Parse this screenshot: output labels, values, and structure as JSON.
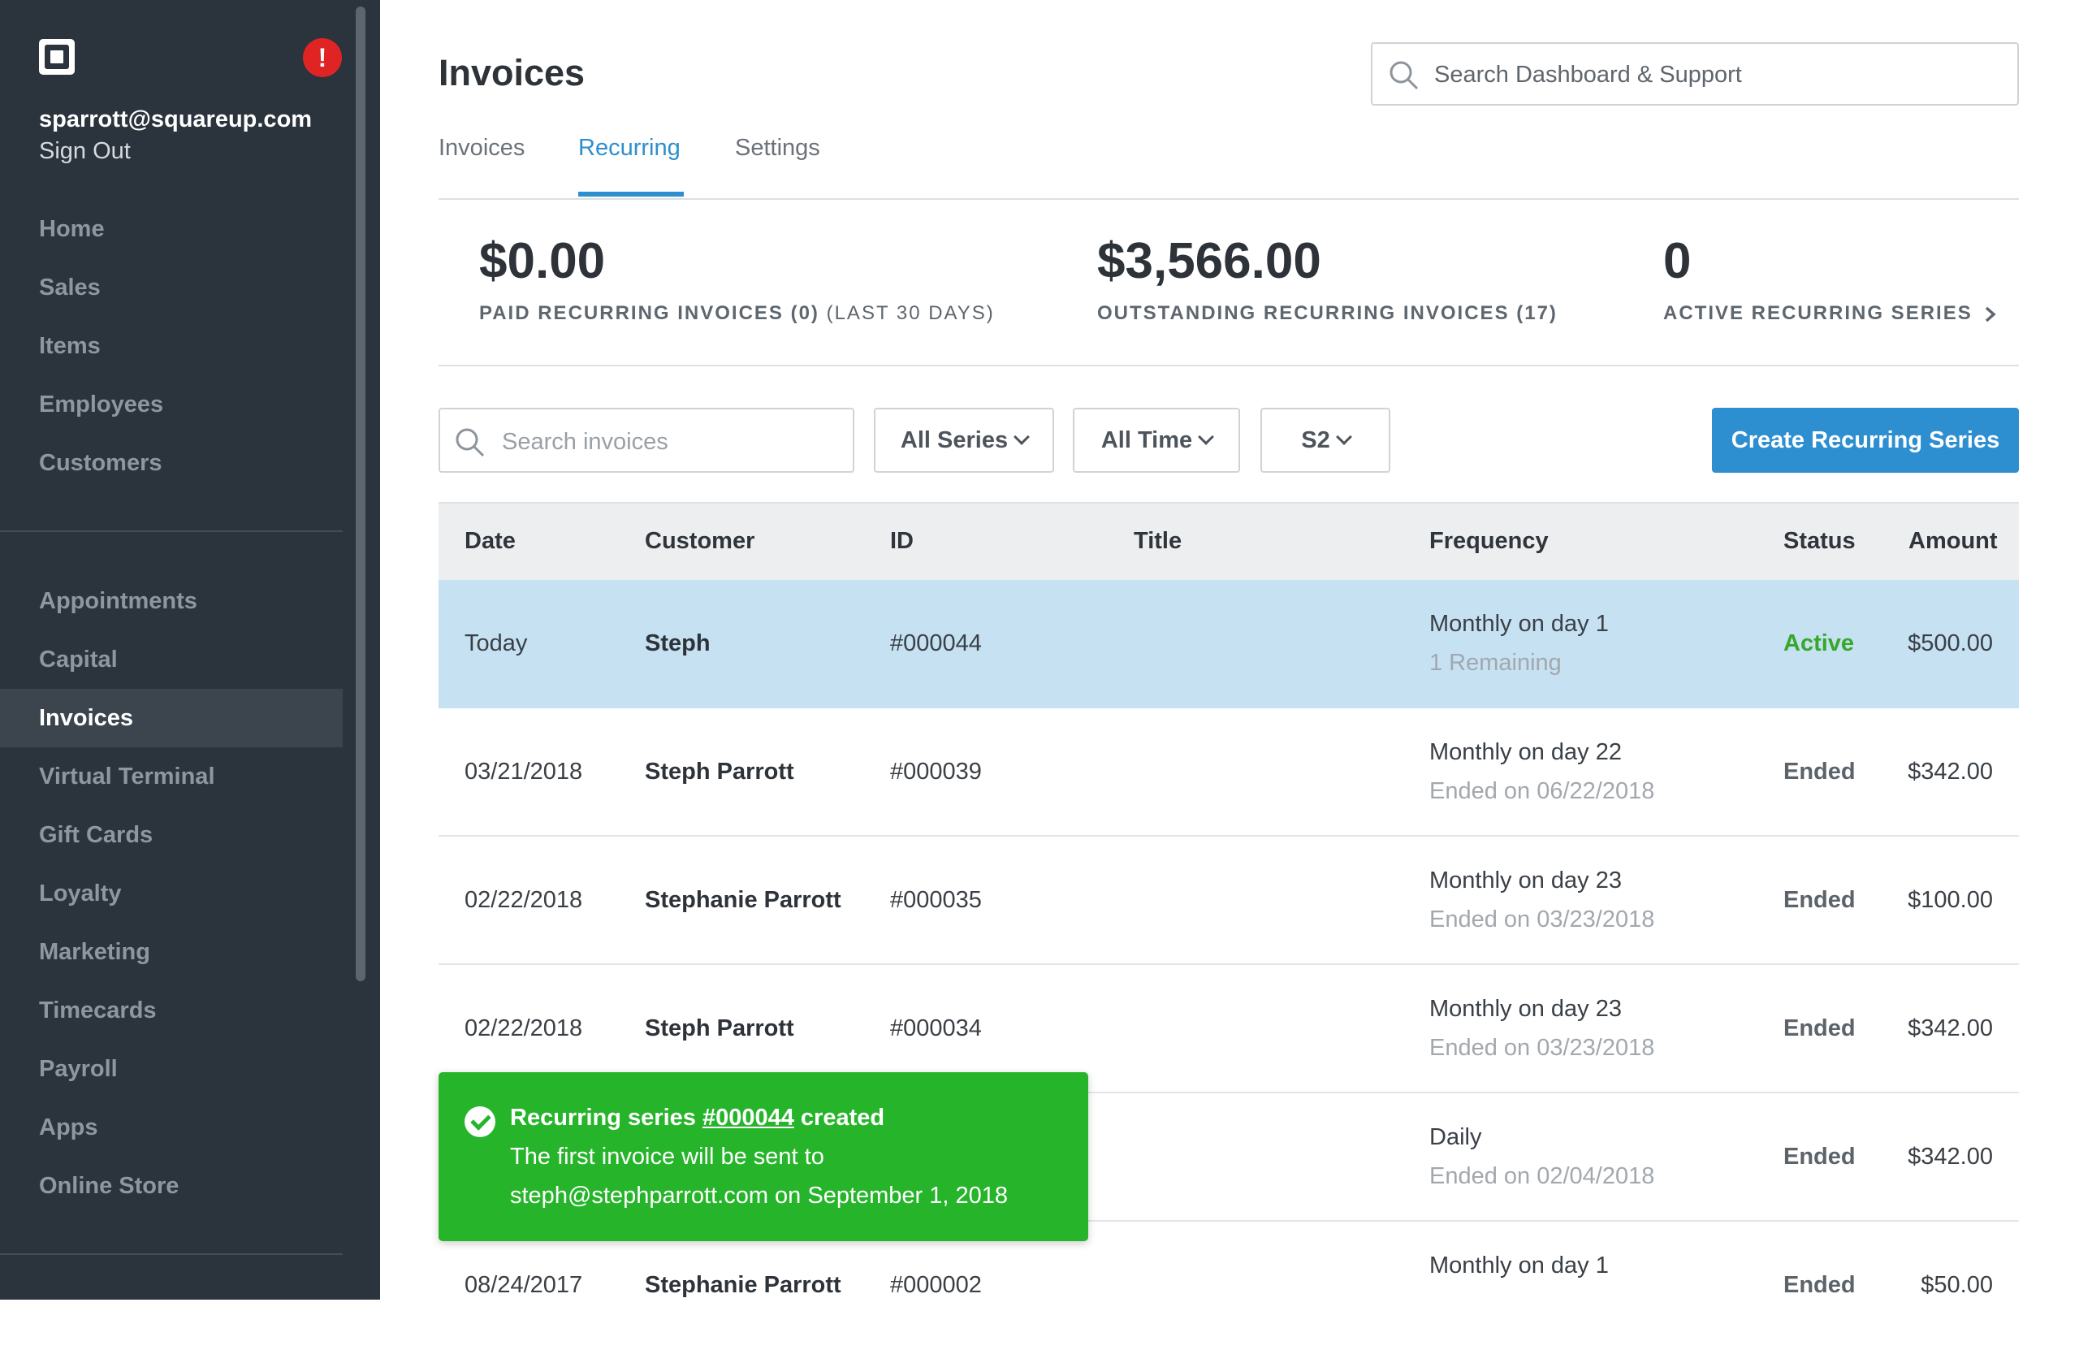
{
  "account": {
    "email": "sparrott@squareup.com",
    "sign_out": "Sign Out",
    "alert": "!"
  },
  "sidebar": {
    "primary": [
      "Home",
      "Sales",
      "Items",
      "Employees",
      "Customers"
    ],
    "secondary": [
      "Appointments",
      "Capital",
      "Invoices",
      "Virtual Terminal",
      "Gift Cards",
      "Loyalty",
      "Marketing",
      "Timecards",
      "Payroll",
      "Apps",
      "Online Store"
    ],
    "active": "Invoices"
  },
  "header": {
    "title": "Invoices",
    "search_placeholder": "Search Dashboard & Support",
    "tabs": [
      "Invoices",
      "Recurring",
      "Settings"
    ],
    "active_tab": "Recurring"
  },
  "stats": [
    {
      "value": "$0.00",
      "label": "PAID RECURRING INVOICES (0)",
      "label_suffix": "(LAST 30 DAYS)"
    },
    {
      "value": "$3,566.00",
      "label": "OUTSTANDING RECURRING INVOICES (17)"
    },
    {
      "value": "0",
      "label": "ACTIVE RECURRING SERIES"
    }
  ],
  "filters": {
    "search_placeholder": "Search invoices",
    "series": "All Series",
    "time": "All Time",
    "location": "S2",
    "create_label": "Create Recurring Series"
  },
  "table": {
    "columns": [
      "Date",
      "Customer",
      "ID",
      "Title",
      "Frequency",
      "Status",
      "Amount"
    ],
    "rows": [
      {
        "date": "Today",
        "customer": "Steph",
        "id": "#000044",
        "title": "",
        "frequency": "Monthly on day 1",
        "detail": "1 Remaining",
        "status": "Active",
        "amount": "$500.00"
      },
      {
        "date": "03/21/2018",
        "customer": "Steph Parrott",
        "id": "#000039",
        "title": "",
        "frequency": "Monthly on day 22",
        "detail": "Ended on 06/22/2018",
        "status": "Ended",
        "amount": "$342.00"
      },
      {
        "date": "02/22/2018",
        "customer": "Stephanie Parrott",
        "id": "#000035",
        "title": "",
        "frequency": "Monthly on day 23",
        "detail": "Ended on 03/23/2018",
        "status": "Ended",
        "amount": "$100.00"
      },
      {
        "date": "02/22/2018",
        "customer": "Steph Parrott",
        "id": "#000034",
        "title": "",
        "frequency": "Monthly on day 23",
        "detail": "Ended on 03/23/2018",
        "status": "Ended",
        "amount": "$342.00"
      },
      {
        "date": "",
        "customer": "",
        "id": "",
        "title": "",
        "frequency": "Daily",
        "detail": "Ended on 02/04/2018",
        "status": "Ended",
        "amount": "$342.00"
      },
      {
        "date": "08/24/2017",
        "customer": "Stephanie Parrott",
        "id": "#000002",
        "title": "",
        "frequency": "Monthly on day 1",
        "detail": "",
        "status": "Ended",
        "amount": "$50.00"
      }
    ]
  },
  "toast": {
    "prefix": "Recurring series",
    "link": "#000044",
    "suffix": "created",
    "line2": "The first invoice will be sent to",
    "line3": "steph@stephparrott.com on September 1, 2018"
  },
  "colors": {
    "sidebar": "#2b333c",
    "accent": "#2e8fd0",
    "selected_row": "#c5e1f2",
    "active_status": "#36a82a",
    "toast": "#26b52a",
    "alert": "#e02424"
  }
}
